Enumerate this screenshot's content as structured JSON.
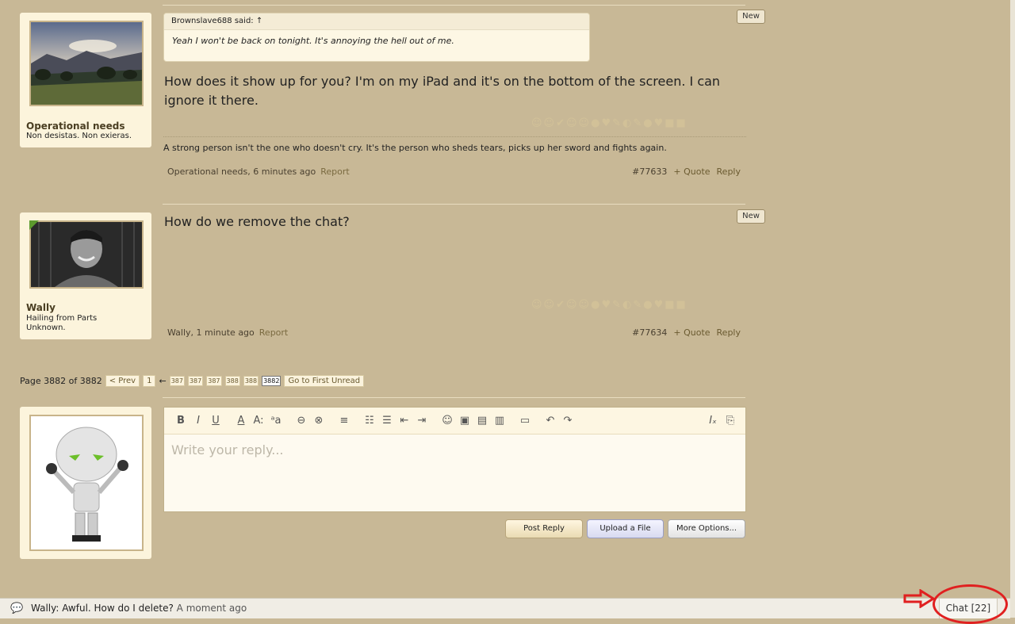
{
  "posts": [
    {
      "username": "Operational needs",
      "user_title": "Non desistas. Non exieras.",
      "quote_author": "Brownslave688 said: ↑",
      "quote_text": "Yeah I won't be back on tonight. It's annoying the hell out of me.",
      "message": "How does it show up for you? I'm on my iPad and it's on the bottom of the screen. I can ignore it there.",
      "signature": "A strong person isn't the one who doesn't cry. It's the person who sheds tears, picks up her sword and fights again.",
      "meta": "Operational needs, 6 minutes ago",
      "report": "Report",
      "post_number": "#77633",
      "quote_label": "+ Quote",
      "reply_label": "Reply",
      "badge": "New"
    },
    {
      "username": "Wally",
      "user_title": "Hailing from Parts Unknown.",
      "message": "How do we remove the chat?",
      "meta": "Wally, 1 minute ago",
      "report": "Report",
      "post_number": "#77634",
      "quote_label": "+ Quote",
      "reply_label": "Reply",
      "badge": "New"
    }
  ],
  "pagination": {
    "label": "Page 3882 of 3882",
    "prev": "< Prev",
    "first_page": "1",
    "ellipsis": "←",
    "pages": [
      "387",
      "387",
      "387",
      "388",
      "388"
    ],
    "current": "3882",
    "first_unread": "Go to First Unread"
  },
  "editor": {
    "placeholder": "Write your reply..."
  },
  "buttons": {
    "post_reply": "Post Reply",
    "upload": "Upload a File",
    "more_options": "More Options..."
  },
  "chat": {
    "last_message": "Wally: Awful. How do I delete?",
    "ago": "A moment ago",
    "button": "Chat [22]"
  },
  "colors": {
    "background": "#c8b896",
    "annotation": "#e02020"
  }
}
